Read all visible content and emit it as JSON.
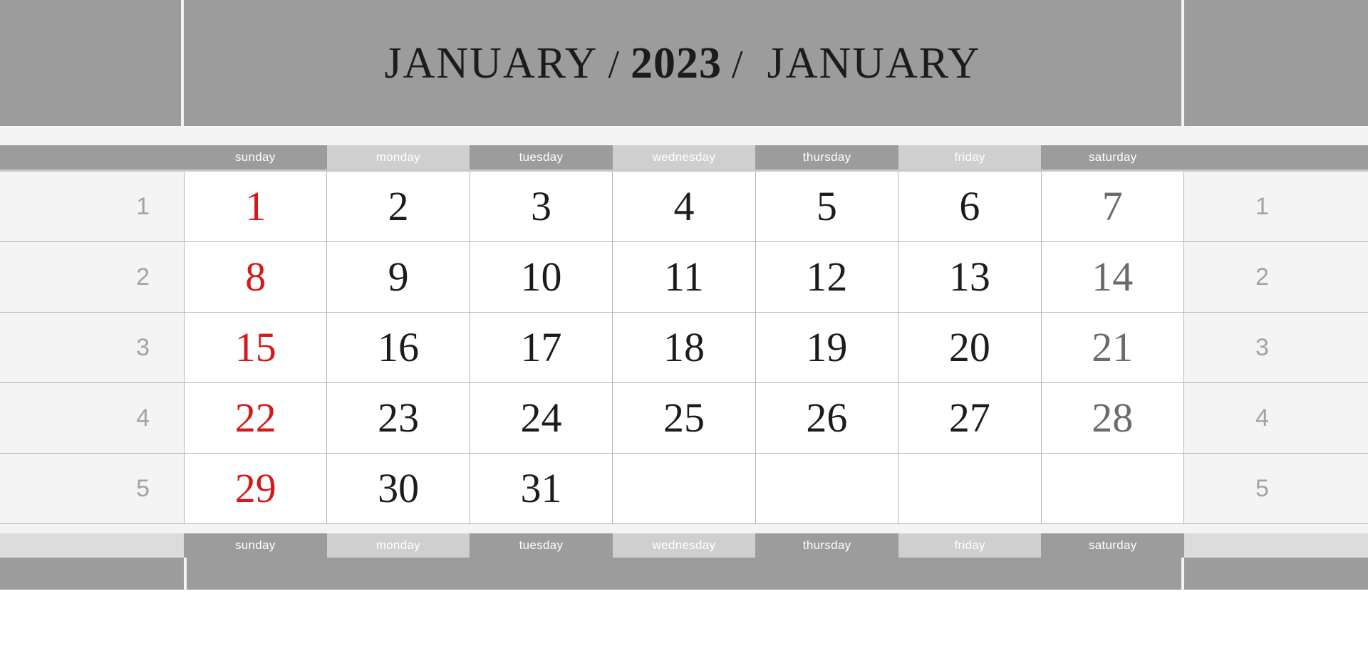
{
  "header": {
    "month_left": "JANUARY",
    "separator_left": "/",
    "year": "2023",
    "separator_right": "/",
    "month_right": "JANUARY"
  },
  "weekdays": [
    {
      "label": "sunday",
      "shade": "dark"
    },
    {
      "label": "monday",
      "shade": "light"
    },
    {
      "label": "tuesday",
      "shade": "dark"
    },
    {
      "label": "wednesday",
      "shade": "light"
    },
    {
      "label": "thursday",
      "shade": "dark"
    },
    {
      "label": "friday",
      "shade": "light"
    },
    {
      "label": "saturday",
      "shade": "dark"
    }
  ],
  "week_numbers": [
    "1",
    "2",
    "3",
    "4",
    "5"
  ],
  "weeks": [
    {
      "number": "1",
      "days": [
        "1",
        "2",
        "3",
        "4",
        "5",
        "6",
        "7"
      ]
    },
    {
      "number": "2",
      "days": [
        "8",
        "9",
        "10",
        "11",
        "12",
        "13",
        "14"
      ]
    },
    {
      "number": "3",
      "days": [
        "15",
        "16",
        "17",
        "18",
        "19",
        "20",
        "21"
      ]
    },
    {
      "number": "4",
      "days": [
        "22",
        "23",
        "24",
        "25",
        "26",
        "27",
        "28"
      ]
    },
    {
      "number": "5",
      "days": [
        "29",
        "30",
        "31",
        "",
        "",
        "",
        ""
      ]
    }
  ],
  "colors": {
    "banner": "#9c9c9c",
    "band": "#f4f4f4",
    "weekday_dark": "#9c9c9c",
    "weekday_light": "#cfcfcf",
    "weeknum_bg": "#f4f4f4",
    "sunday_text": "#d61818",
    "saturday_text": "#6b6b6b",
    "day_text": "#1c1c1c",
    "grid_line": "#b6b6b6"
  }
}
